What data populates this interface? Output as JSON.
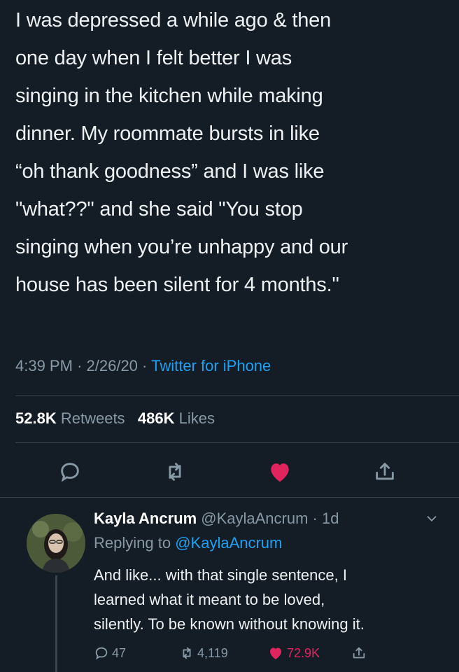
{
  "tweet": {
    "text": "I was depressed a while ago & then\none day when I felt better I was\nsinging in the kitchen while making\ndinner. My roommate bursts in like\n“oh thank goodness” and I was like\n\"what??\" and she said \"You stop\nsinging when you’re unhappy and our\nhouse has been silent for 4 months.\"",
    "time": "4:39 PM",
    "date": "2/26/20",
    "source": "Twitter for iPhone",
    "retweets_count": "52.8K",
    "retweets_label": "Retweets",
    "likes_count": "486K",
    "likes_label": "Likes",
    "liked": true,
    "icons": [
      "reply-icon",
      "retweet-icon",
      "heart-icon",
      "share-icon"
    ],
    "like_color": "#e0245e"
  },
  "reply": {
    "name": "Kayla Ancrum",
    "handle": "@KaylaAncrum",
    "age": "1d",
    "replying_prefix": "Replying to",
    "replying_to": "@KaylaAncrum",
    "text": "And like... with that single sentence, I\nlearned what it meant to be loved,\nsilently. To be known without knowing it.",
    "reply_count": "47",
    "retweet_count": "4,119",
    "like_count": "72.9K"
  },
  "colors": {
    "background": "#141d26",
    "accent": "#1da1f2",
    "muted": "#8899a6"
  }
}
